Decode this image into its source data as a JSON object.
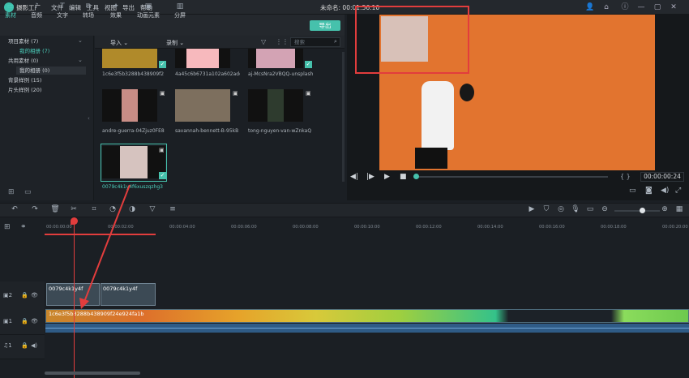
{
  "app": {
    "name": "摄影工厂",
    "title": "未命名:",
    "timecode": "00:01:56:10"
  },
  "menu": [
    "文件",
    "编辑",
    "工具",
    "视图",
    "导出",
    "帮助"
  ],
  "tools": [
    {
      "label": "素材",
      "icon": "folder-icon"
    },
    {
      "label": "音频",
      "icon": "music-icon"
    },
    {
      "label": "文字",
      "icon": "text-icon"
    },
    {
      "label": "转场",
      "icon": "transition-icon"
    },
    {
      "label": "效果",
      "icon": "effects-icon"
    },
    {
      "label": "动画元素",
      "icon": "image-icon"
    },
    {
      "label": "分屏",
      "icon": "split-icon"
    }
  ],
  "export_label": "导出",
  "sidebar": {
    "items": [
      {
        "label": "项目素材 (7)",
        "level": 0
      },
      {
        "label": "我的相册 (7)",
        "level": 1
      },
      {
        "label": "共用素材 (0)",
        "level": 0
      },
      {
        "label": "我的相册 (0)",
        "level": 1
      },
      {
        "label": "背景样例 (15)",
        "level": 0
      },
      {
        "label": "片头样例 (20)",
        "level": 0
      }
    ]
  },
  "media_bar": {
    "import": "导入",
    "record": "录制",
    "search_placeholder": "搜索"
  },
  "media": [
    {
      "name": "1c6e3f5b3288b438909f2",
      "color": "#b08a2a"
    },
    {
      "name": "4a45c6b6731a102a602add1",
      "color": "#f7b9bd"
    },
    {
      "name": "aj-McsNra2VBQQ-unsplash",
      "color": "#d3a3b4"
    },
    {
      "name": "andre-guerra-04Zjuz0FE8",
      "color": "#c98d86"
    },
    {
      "name": "savannah-bennett-B-95kB",
      "color": "#7d6f5e"
    },
    {
      "name": "tong-nguyen-van-wZnkaQ",
      "color": "#2e3b2e"
    },
    {
      "name": "0079c4k1y4f6xuszqzhg3",
      "color": "#d6c3bf"
    }
  ],
  "preview": {
    "time": "00:00:00:24"
  },
  "ruler": [
    "00:00:00:00",
    "00:00:02:00",
    "00:00:04:00",
    "00:00:06:00",
    "00:00:08:00",
    "00:00:10:00",
    "00:00:12:00",
    "00:00:14:00",
    "00:00:16:00",
    "00:00:18:00",
    "00:00:20:00"
  ],
  "clips": {
    "pip_a": "0079c4k1y4f",
    "pip_b": "0079c4k1y4f",
    "video": "1c6e3f5b3288b438909f24e924fa1b"
  },
  "track_labels": [
    "2",
    "1",
    "1"
  ]
}
